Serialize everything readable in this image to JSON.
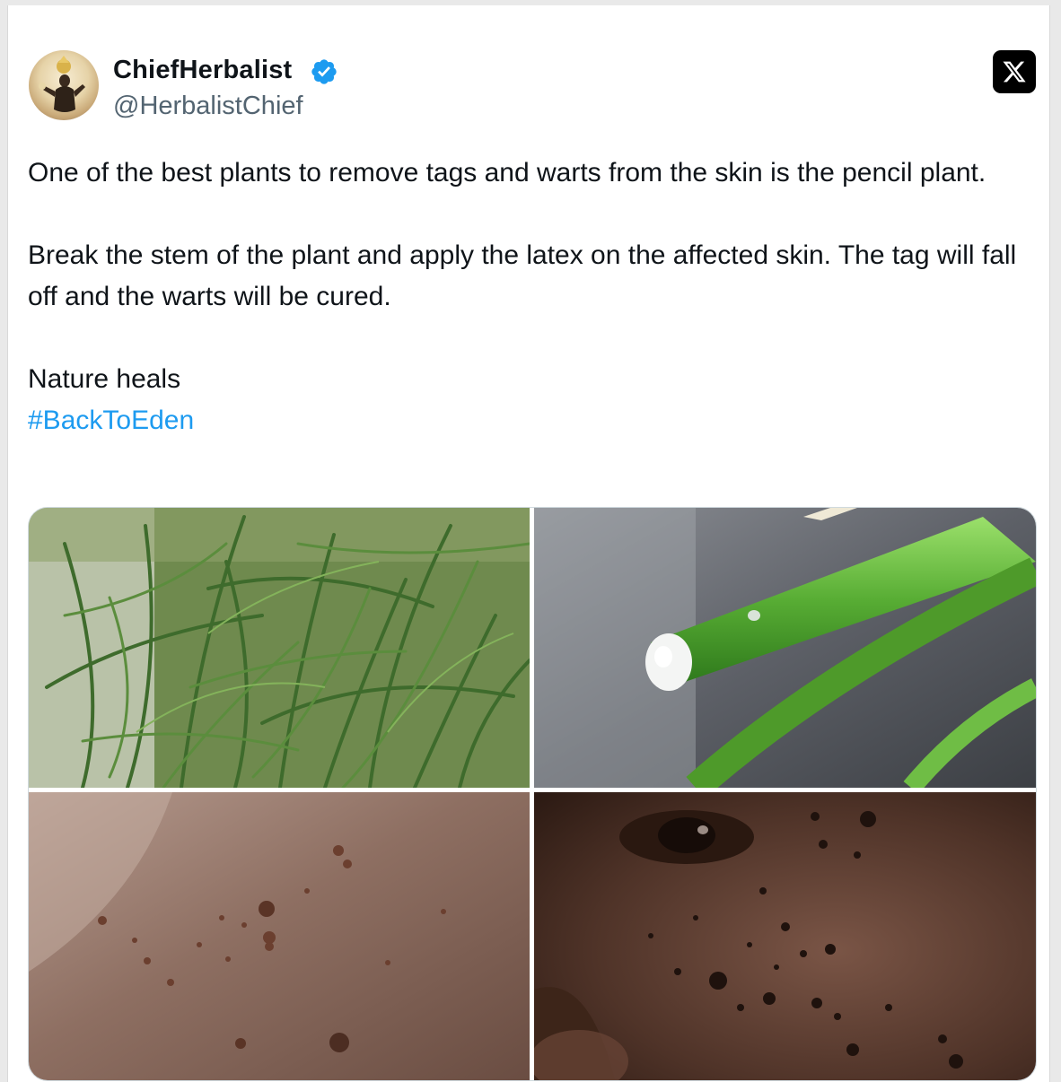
{
  "tweet": {
    "author_name": "ChiefHerbalist",
    "author_handle": "@HerbalistChief",
    "verified": true,
    "paragraphs": [
      "One of the best plants to remove tags and warts from the skin is the pencil plant.",
      "Break the stem of the plant and apply the latex on the affected skin. The tag will fall off and the warts will be cured.",
      "Nature heals"
    ],
    "hashtag": "#BackToEden"
  },
  "icons": {
    "verified": "verified-badge-icon",
    "platform": "x-logo-icon"
  },
  "colors": {
    "hashtag": "#1d9bf0",
    "verified_badge": "#1d9bf0",
    "text": "#0f1419",
    "secondary_text": "#536471"
  },
  "media": [
    {
      "name": "pencil-plant-photo"
    },
    {
      "name": "broken-stem-latex-photo"
    },
    {
      "name": "skin-tags-neck-photo"
    },
    {
      "name": "skin-tags-face-photo"
    }
  ]
}
